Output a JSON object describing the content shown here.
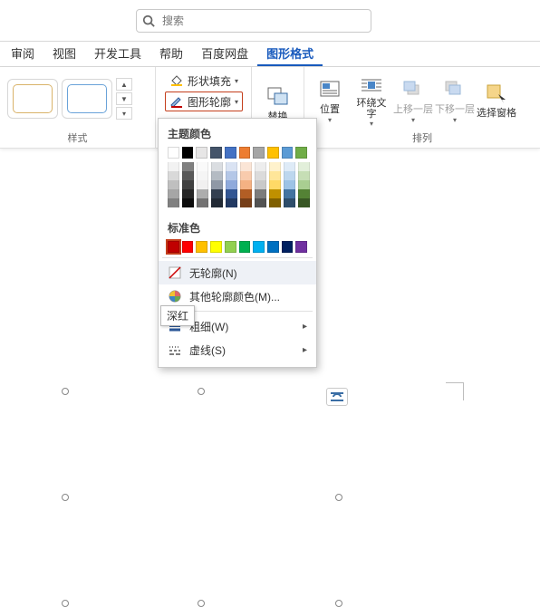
{
  "search": {
    "placeholder": "搜索"
  },
  "tabs": {
    "review": "审阅",
    "view": "视图",
    "devtools": "开发工具",
    "help": "帮助",
    "baidu": "百度网盘",
    "shapefmt": "图形格式"
  },
  "ribbon": {
    "styles_group_label": "样式",
    "shape_fill": "形状填充",
    "shape_outline": "图形轮廓",
    "replace_label": "替换",
    "position_label": "位置",
    "wrap_label": "环绕文\n字",
    "bring_fwd": "上移一层",
    "send_back": "下移一层",
    "selection_pane": "选择窗格",
    "arrange_group_label": "排列"
  },
  "dropdown": {
    "theme_title": "主题颜色",
    "standard_title": "标准色",
    "no_outline": "无轮廓(N)",
    "more_colors": "其他轮廓颜色(M)...",
    "weight": "粗细(W)",
    "dashes": "虚线(S)",
    "tooltip": "深红",
    "theme_row": [
      "#ffffff",
      "#000000",
      "#e7e6e6",
      "#44546a",
      "#4472c4",
      "#ed7d31",
      "#a5a5a5",
      "#ffc000",
      "#5b9bd5",
      "#70ad47"
    ],
    "standard_row": [
      "#c00000",
      "#ff0000",
      "#ffc000",
      "#ffff00",
      "#92d050",
      "#00b050",
      "#00b0f0",
      "#0070c0",
      "#002060",
      "#7030a0"
    ],
    "shade_levels": [
      0.92,
      0.8,
      0.64,
      0.48,
      0.3
    ],
    "selected_standard_index": 0
  },
  "colors": {
    "accent": "#185abd",
    "highlight_border": "#c43e1c"
  }
}
